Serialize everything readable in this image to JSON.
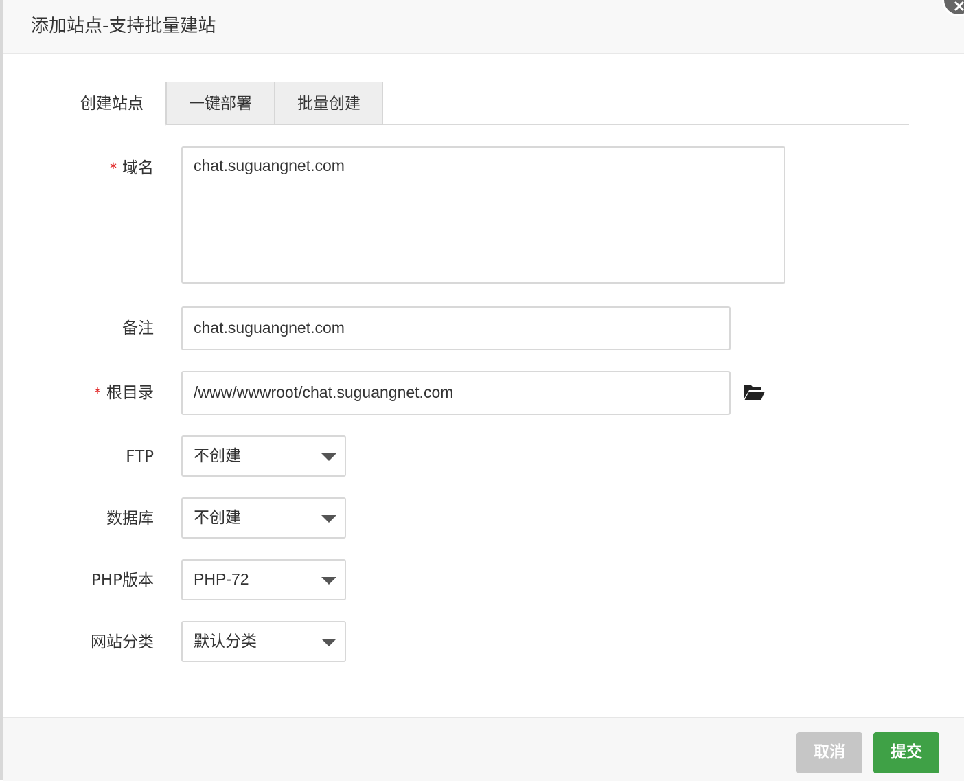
{
  "dialog": {
    "title": "添加站点-支持批量建站"
  },
  "tabs": [
    {
      "label": "创建站点",
      "active": true
    },
    {
      "label": "一键部署",
      "active": false
    },
    {
      "label": "批量创建",
      "active": false
    }
  ],
  "form": {
    "required_mark": "*",
    "domain": {
      "label": "域名",
      "value": "chat.suguangnet.com"
    },
    "remark": {
      "label": "备注",
      "value": "chat.suguangnet.com"
    },
    "root": {
      "label": "根目录",
      "value": "/www/wwwroot/chat.suguangnet.com"
    },
    "ftp": {
      "label": "FTP",
      "selected": "不创建"
    },
    "database": {
      "label": "数据库",
      "selected": "不创建"
    },
    "php": {
      "label": "PHP版本",
      "selected": "PHP-72"
    },
    "category": {
      "label": "网站分类",
      "selected": "默认分类"
    }
  },
  "footer": {
    "cancel_label": "取消",
    "submit_label": "提交"
  },
  "colors": {
    "accent": "#3fa146",
    "cancel": "#c6c6c6",
    "required": "#e02020"
  },
  "icons": {
    "folder": "folder-open-icon",
    "close": "close-icon",
    "caret": "caret-down-icon"
  }
}
